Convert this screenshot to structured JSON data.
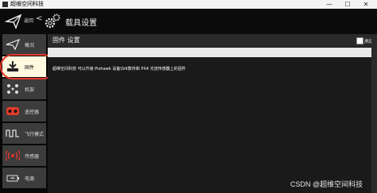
{
  "window": {
    "title": "超维空间科技",
    "minimize_glyph": "—",
    "maximize_glyph": "☐",
    "close_glyph": "✕"
  },
  "header": {
    "back_label": "返回",
    "back_glyph": "<",
    "title": "载具设置",
    "app_icon": "paper-plane-icon",
    "section_icon": "gear-icon"
  },
  "sidebar": {
    "items": [
      {
        "label": "概况",
        "icon": "paper-plane-icon",
        "active": false
      },
      {
        "label": "固件",
        "icon": "download-icon",
        "active": true
      },
      {
        "label": "机架",
        "icon": "frame-icon",
        "active": false
      },
      {
        "label": "遥控器",
        "icon": "remote-icon",
        "active": false
      },
      {
        "label": "飞行模式",
        "icon": "wave-icon",
        "active": false
      },
      {
        "label": "传感器",
        "icon": "signal-icon",
        "active": false
      },
      {
        "label": "电源",
        "icon": "battery-icon",
        "active": false
      }
    ]
  },
  "main": {
    "title": "固件 设置",
    "advanced_label": "高级",
    "message": "超维空间科技 可以升级 Pixhawk 设备\\SiK数传和 PX4 光流传感器上的固件"
  },
  "watermark": "CSDN @超维空间科技",
  "colors": {
    "highlight": "#e83a2c",
    "active_bg": "#fff9e0",
    "sidebar_item_bg": "#3c3c3c"
  }
}
